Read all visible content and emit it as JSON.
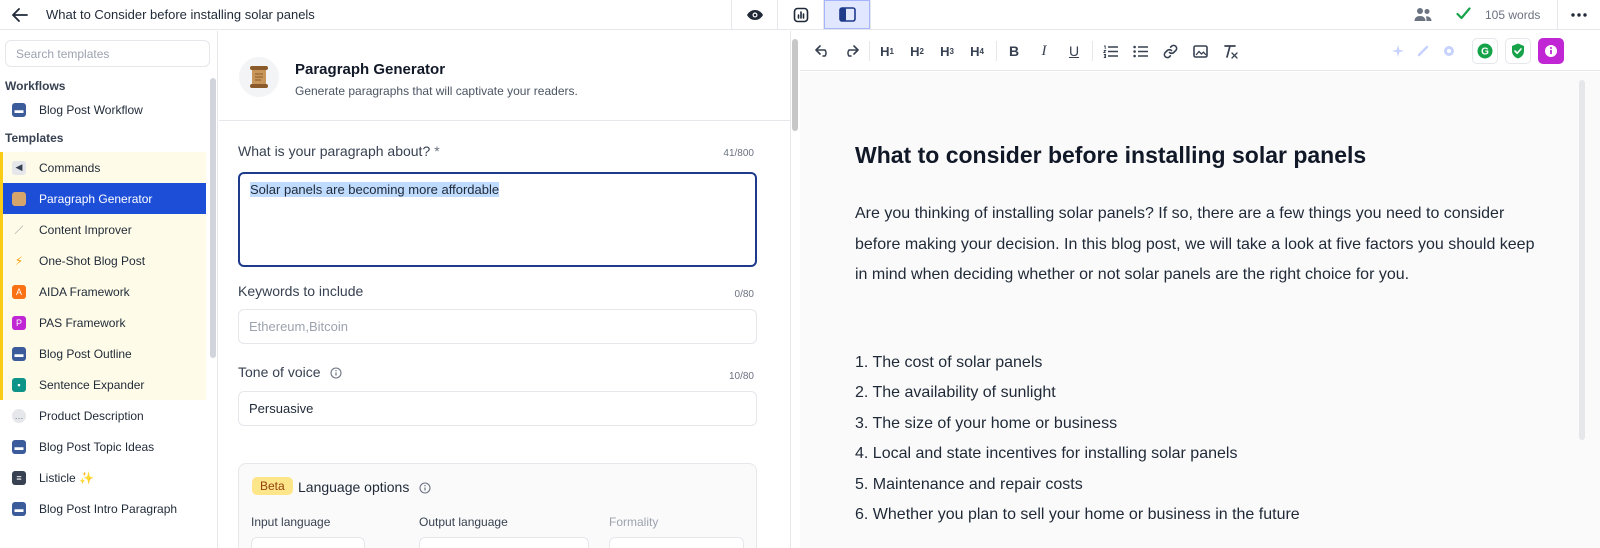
{
  "topbar": {
    "title": "What to Consider before installing solar panels",
    "word_count": "105 words"
  },
  "sidebar": {
    "search_placeholder": "Search templates",
    "workflows_label": "Workflows",
    "workflows": [
      {
        "label": "Blog Post Workflow",
        "icon": "chat-icon"
      }
    ],
    "templates_label": "Templates",
    "items": [
      {
        "label": "Commands",
        "icon": "megaphone-icon",
        "highlighted": true
      },
      {
        "label": "Paragraph Generator",
        "icon": "scroll-icon",
        "highlighted": true,
        "active": true
      },
      {
        "label": "Content Improver",
        "icon": "wand-icon",
        "highlighted": true
      },
      {
        "label": "One-Shot Blog Post",
        "icon": "lightning-icon",
        "highlighted": true
      },
      {
        "label": "AIDA Framework",
        "icon": "aida-icon",
        "highlighted": true
      },
      {
        "label": "PAS Framework",
        "icon": "pas-icon",
        "highlighted": true
      },
      {
        "label": "Blog Post Outline",
        "icon": "chat-icon",
        "highlighted": true
      },
      {
        "label": "Sentence Expander",
        "icon": "expander-icon",
        "highlighted": true
      },
      {
        "label": "Product Description",
        "icon": "speech-bubble-icon"
      },
      {
        "label": "Blog Post Topic Ideas",
        "icon": "chat-icon"
      },
      {
        "label": "Listicle ✨",
        "icon": "list-icon"
      },
      {
        "label": "Blog Post Intro Paragraph",
        "icon": "chat-icon"
      }
    ]
  },
  "form": {
    "title": "Paragraph Generator",
    "subtitle": "Generate paragraphs that will captivate your readers.",
    "about_label": "What is your paragraph about?",
    "about_required": "*",
    "about_counter": "41/800",
    "about_value": "Solar panels are becoming more affordable",
    "keywords_label": "Keywords to include",
    "keywords_counter": "0/80",
    "keywords_placeholder": "Ethereum,Bitcoin",
    "tone_label": "Tone of voice",
    "tone_counter": "10/80",
    "tone_value": "Persuasive",
    "lang_badge": "Beta",
    "lang_title": "Language options",
    "input_language_label": "Input language",
    "output_language_label": "Output language",
    "formality_label": "Formality"
  },
  "editor": {
    "toolbar": [
      "undo",
      "redo",
      "H1",
      "H2",
      "H3",
      "H4",
      "bold",
      "italic",
      "underline",
      "ordered-list",
      "bullet-list",
      "link",
      "image",
      "clear-format"
    ],
    "heading": "What to consider before installing solar panels",
    "paragraph": "Are you thinking of installing solar panels? If so, there are a few things you need to consider before making your decision. In this blog post, we will take a look at five factors you should keep in mind when deciding whether or not solar panels are the right choice for you.",
    "list": [
      "1. The cost of solar panels",
      "2. The availability of sunlight",
      "3. The size of your home or business",
      "4. Local and state incentives for installing solar panels",
      "5. Maintenance and repair costs",
      "6. Whether you plan to sell your home or business in the future"
    ]
  },
  "colors": {
    "accent": "#1d4ed8",
    "highlight_bg": "#fefce8",
    "highlight_border": "#facc15",
    "selection": "#bfdbfe",
    "grammarly_green": "#15a34a",
    "extension_purple": "#c026d3"
  }
}
